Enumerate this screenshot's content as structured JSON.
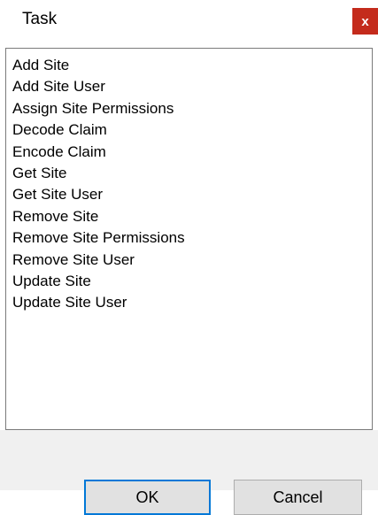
{
  "window": {
    "title": "Task",
    "close_label": "x"
  },
  "task_list": {
    "items": [
      "Add Site",
      "Add Site User",
      "Assign Site Permissions",
      "Decode Claim",
      "Encode Claim",
      "Get Site",
      "Get Site User",
      "Remove Site",
      "Remove Site Permissions",
      "Remove Site User",
      "Update Site",
      "Update Site User"
    ]
  },
  "buttons": {
    "ok_label": "OK",
    "cancel_label": "Cancel"
  },
  "colors": {
    "close_button": "#c42b1c",
    "default_button_border": "#0078d7",
    "footer_background": "#f0f0f0"
  }
}
